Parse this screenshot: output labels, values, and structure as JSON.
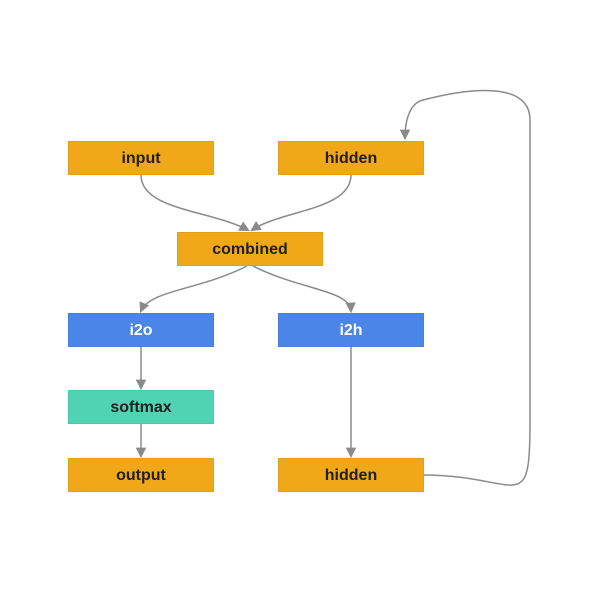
{
  "nodes": {
    "input": {
      "label": "input",
      "color": "orange"
    },
    "hidden1": {
      "label": "hidden",
      "color": "orange"
    },
    "combined": {
      "label": "combined",
      "color": "orange"
    },
    "i2o": {
      "label": "i2o",
      "color": "blue"
    },
    "i2h": {
      "label": "i2h",
      "color": "blue"
    },
    "softmax": {
      "label": "softmax",
      "color": "teal"
    },
    "output": {
      "label": "output",
      "color": "orange"
    },
    "hidden2": {
      "label": "hidden",
      "color": "orange"
    }
  },
  "colors": {
    "orange": "#f0a818",
    "blue": "#4a86e8",
    "teal": "#4fd3b3",
    "arrow": "#8a8a8a"
  }
}
